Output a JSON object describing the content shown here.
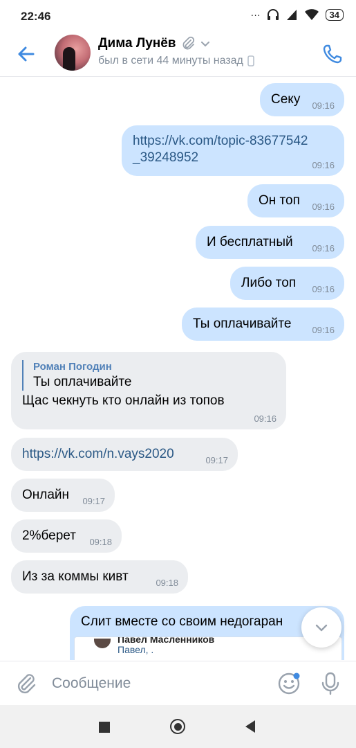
{
  "status_bar": {
    "time": "22:46",
    "battery": "34"
  },
  "header": {
    "contact_name": "Дима Лунёв",
    "status_text": "был в сети 44 минуты назад"
  },
  "messages": [
    {
      "dir": "out",
      "text": "Секу",
      "time": "09:16"
    },
    {
      "dir": "out",
      "text_line1": "https://vk.com/topic-83677542",
      "text_line2": "_39248952",
      "time": "09:16"
    },
    {
      "dir": "out",
      "text": "Он топ",
      "time": "09:16"
    },
    {
      "dir": "out",
      "text": "И бесплатный",
      "time": "09:16"
    },
    {
      "dir": "out",
      "text": "Либо топ",
      "time": "09:16"
    },
    {
      "dir": "out",
      "text": "Ты оплачивайте",
      "time": "09:16"
    },
    {
      "dir": "in",
      "reply_author": "Роман Погодин",
      "reply_text": "Ты оплачивайте",
      "text": "Щас чекнуть кто онлайн из топов",
      "time": "09:16"
    },
    {
      "dir": "in",
      "text": "https://vk.com/n.vays2020",
      "time": "09:17"
    },
    {
      "dir": "in",
      "text": "Онлайн",
      "time": "09:17"
    },
    {
      "dir": "in",
      "text": "2%берет",
      "time": "09:18"
    },
    {
      "dir": "in",
      "text": "Из за коммы кивт",
      "time": "09:18"
    },
    {
      "dir": "out",
      "text": "Слит вместе со своим недогаран",
      "forward_author": "Павел Масленников",
      "forward_text": "Павел, ."
    }
  ],
  "composer": {
    "placeholder": "Сообщение"
  },
  "icons": {
    "back": "arrow-left-icon",
    "attachment_badge": "paperclip-icon",
    "dropdown": "chevron-down-icon",
    "mobile": "mobile-icon",
    "call": "phone-icon",
    "scroll_down": "chevron-down-icon",
    "attach": "paperclip-icon",
    "emoji": "smile-icon",
    "voice": "microphone-icon"
  },
  "colors": {
    "accent": "#3f8ae0",
    "outgoing_bubble": "#cce4ff",
    "incoming_bubble": "#ebedf0",
    "link": "#2a5885",
    "secondary_text": "#818c99"
  }
}
